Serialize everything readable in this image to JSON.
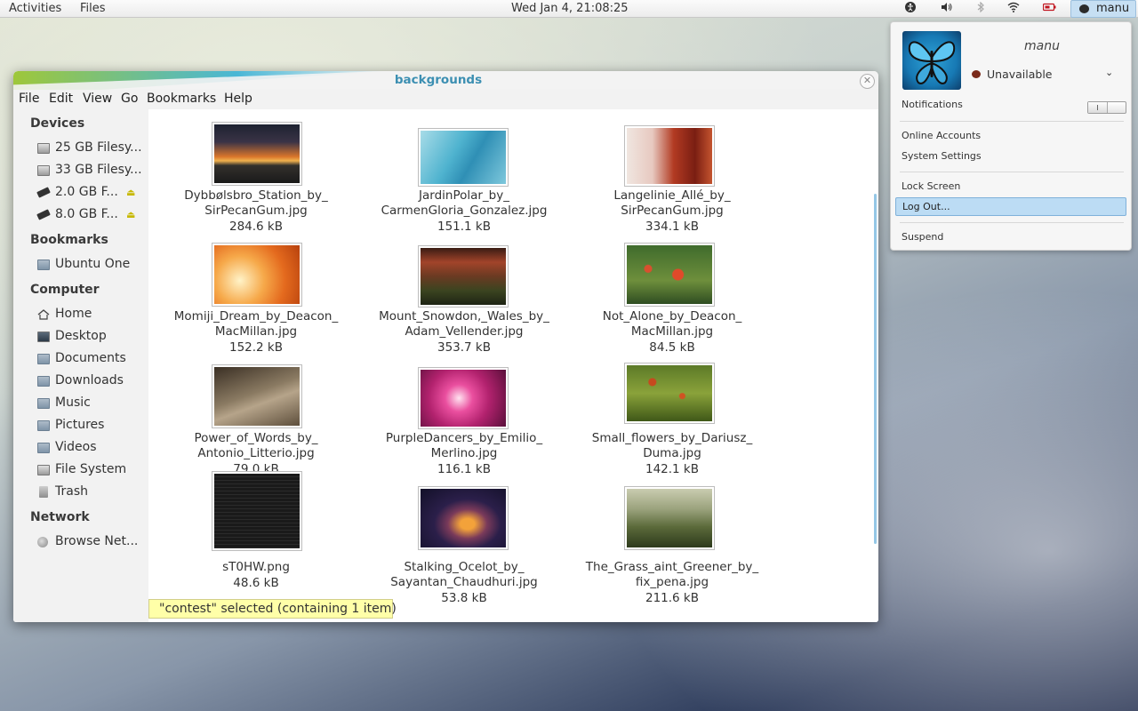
{
  "top_panel": {
    "activities": "Activities",
    "app_menu": "Files",
    "clock": "Wed Jan  4, 21:08:25",
    "icons": [
      "accessibility-icon",
      "volume-icon",
      "bluetooth-icon",
      "wifi-icon",
      "battery-icon"
    ],
    "user": "manu"
  },
  "user_menu": {
    "name": "manu",
    "status": "Unavailable",
    "notifications_label": "Notifications",
    "notifications_on": true,
    "items": [
      "Online Accounts",
      "System Settings",
      "Lock Screen",
      "Log Out...",
      "Suspend"
    ]
  },
  "window": {
    "title": "backgrounds",
    "menus": [
      "File",
      "Edit",
      "View",
      "Go",
      "Bookmarks",
      "Help"
    ]
  },
  "sidebar": {
    "devices_heading": "Devices",
    "devices": [
      "25 GB Filesy...",
      "33 GB Filesy...",
      "2.0 GB F...",
      "8.0 GB F..."
    ],
    "bookmarks_heading": "Bookmarks",
    "bookmarks": [
      "Ubuntu One"
    ],
    "computer_heading": "Computer",
    "computer": [
      "Home",
      "Desktop",
      "Documents",
      "Downloads",
      "Music",
      "Pictures",
      "Videos",
      "File System",
      "Trash"
    ],
    "network_heading": "Network",
    "network": [
      "Browse Net..."
    ]
  },
  "files": [
    {
      "line1": "Dybbølsbro_Station_by_",
      "line2": "SirPecanGum.jpg",
      "size": "284.6 kB"
    },
    {
      "line1": "JardinPolar_by_",
      "line2": "CarmenGloria_Gonzalez.jpg",
      "size": "151.1 kB"
    },
    {
      "line1": "Langelinie_Allé_by_",
      "line2": "SirPecanGum.jpg",
      "size": "334.1 kB"
    },
    {
      "line1": "Momiji_Dream_by_Deacon_",
      "line2": "MacMillan.jpg",
      "size": "152.2 kB"
    },
    {
      "line1": "Mount_Snowdon,_Wales_by_",
      "line2": "Adam_Vellender.jpg",
      "size": "353.7 kB"
    },
    {
      "line1": "Not_Alone_by_Deacon_",
      "line2": "MacMillan.jpg",
      "size": "84.5 kB"
    },
    {
      "line1": "Power_of_Words_by_",
      "line2": "Antonio_Litterio.jpg",
      "size": "79.0 kB"
    },
    {
      "line1": "PurpleDancers_by_Emilio_",
      "line2": "Merlino.jpg",
      "size": "116.1 kB"
    },
    {
      "line1": "Small_flowers_by_Dariusz_",
      "line2": "Duma.jpg",
      "size": "142.1 kB"
    },
    {
      "line1": "sT0HW.png",
      "line2": "",
      "size": "48.6 kB"
    },
    {
      "line1": "Stalking_Ocelot_by_",
      "line2": "Sayantan_Chaudhuri.jpg",
      "size": "53.8 kB"
    },
    {
      "line1": "The_Grass_aint_Greener_by_",
      "line2": "fix_pena.jpg",
      "size": "211.6 kB"
    }
  ],
  "status": "\"contest\" selected (containing 1 item)"
}
